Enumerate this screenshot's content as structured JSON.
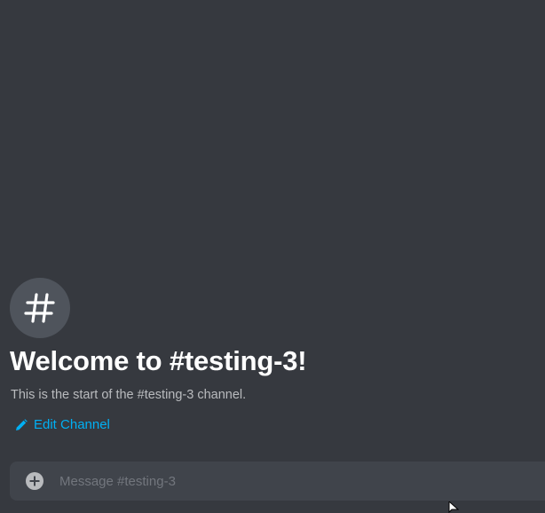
{
  "channel": {
    "name": "testing-3",
    "avatar_glyph": "#",
    "welcome_title": "Welcome to #testing-3!",
    "welcome_description": "This is the start of the #testing-3 channel.",
    "edit_label": "Edit Channel"
  },
  "composer": {
    "placeholder": "Message #testing-3",
    "value": ""
  },
  "icons": {
    "avatar": "hashtag-icon",
    "edit": "pencil-icon",
    "add": "plus-circle-icon",
    "cursor": "mouse-pointer-icon"
  },
  "colors": {
    "background": "#36393f",
    "avatar_bg": "#4f545c",
    "title": "#ffffff",
    "description": "#b9bbbe",
    "link": "#00b0f4",
    "composer_bg": "#40444b",
    "placeholder": "#72767d"
  }
}
